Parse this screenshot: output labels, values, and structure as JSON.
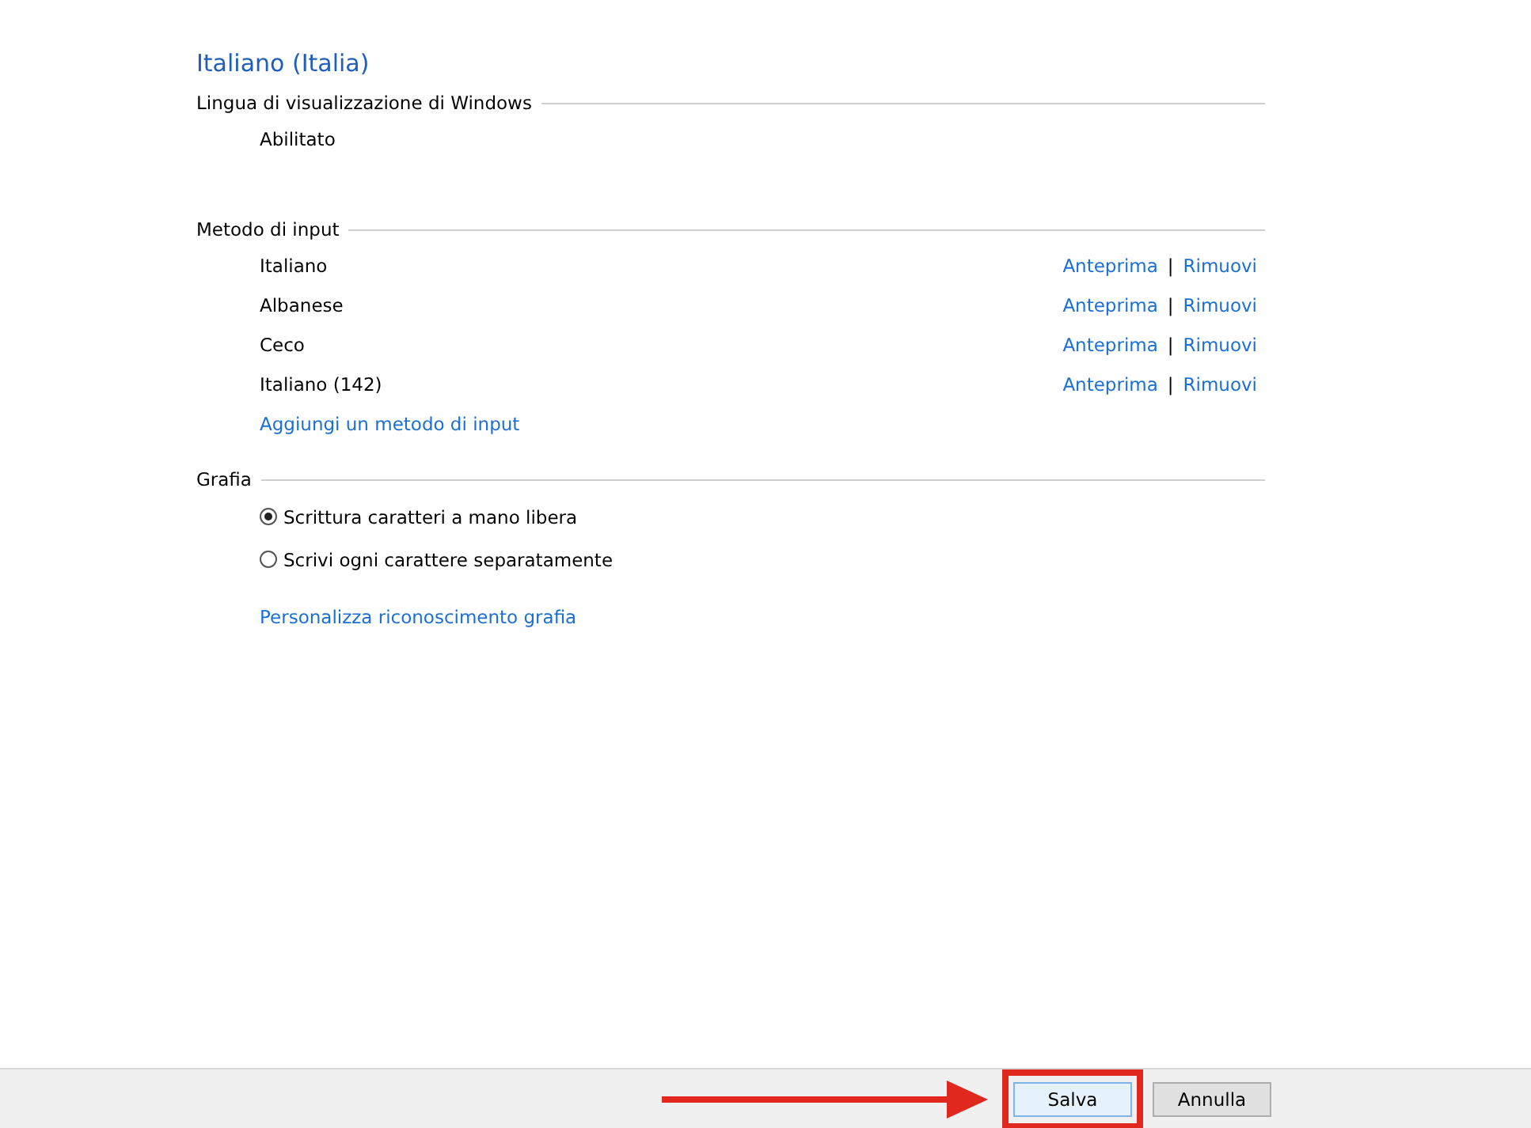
{
  "title": "Italiano (Italia)",
  "sections": [
    {
      "heading": "Lingua di visualizzazione di Windows",
      "items": [
        {
          "kind": "text",
          "label": "Abilitato"
        }
      ]
    },
    {
      "heading": "Metodo di input",
      "items": [
        {
          "kind": "method",
          "label": "Italiano",
          "actions": [
            "Anteprima",
            "Rimuovi"
          ],
          "separator": "|"
        },
        {
          "kind": "method",
          "label": "Albanese",
          "actions": [
            "Anteprima",
            "Rimuovi"
          ],
          "separator": "|"
        },
        {
          "kind": "method",
          "label": "Ceco",
          "actions": [
            "Anteprima",
            "Rimuovi"
          ],
          "separator": "|"
        },
        {
          "kind": "method",
          "label": "Italiano (142)",
          "actions": [
            "Anteprima",
            "Rimuovi"
          ],
          "separator": "|"
        },
        {
          "kind": "link",
          "label": "Aggiungi un metodo di input"
        }
      ]
    },
    {
      "heading": "Grafia",
      "items": [
        {
          "kind": "radio",
          "label": "Scrittura caratteri a mano libera",
          "selected": true
        },
        {
          "kind": "radio",
          "label": "Scrivi ogni carattere separatamente",
          "selected": false
        },
        {
          "kind": "link",
          "label": "Personalizza riconoscimento grafia"
        }
      ]
    }
  ],
  "buttons": [
    {
      "label": "Salva",
      "highlighted": true
    },
    {
      "label": "Annulla",
      "highlighted": false
    }
  ]
}
